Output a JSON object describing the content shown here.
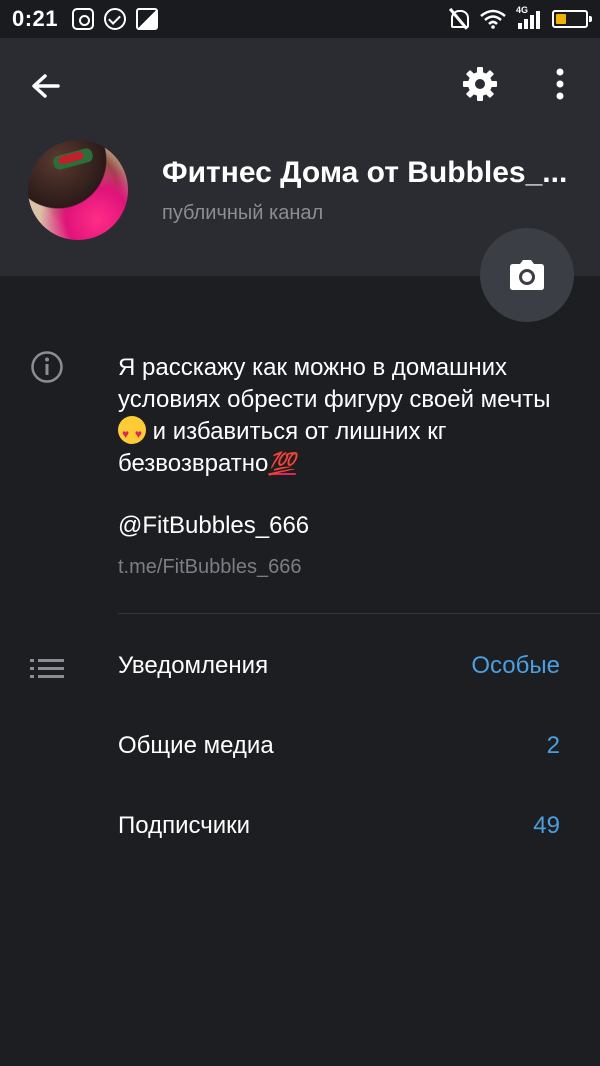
{
  "status_bar": {
    "time": "0:21",
    "network": "4G",
    "battery_level": 0.35,
    "battery_color": "#f0b400",
    "left_icons": [
      "instagram-icon",
      "check-circle-icon",
      "image-icon"
    ],
    "right_icons": [
      "mute-icon",
      "wifi-icon",
      "signal-icon",
      "battery-icon"
    ]
  },
  "toolbar": {
    "back_icon": "arrow-left-icon",
    "settings_icon": "gear-icon",
    "more_icon": "more-vertical-icon"
  },
  "channel": {
    "title": "Фитнес Дома от Bubbles_...",
    "subtitle": "публичный канал"
  },
  "about": {
    "line1": "Я расскажу как можно в домашних условиях обрести фигуру своей мечты ",
    "line2": " и избавиться от лишних кг безвозвратно",
    "emoji_100": "💯",
    "username": "@FitBubbles_666",
    "link": "t.me/FitBubbles_666"
  },
  "settings_rows": [
    {
      "label": "Уведомления",
      "value": "Особые"
    },
    {
      "label": "Общие медиа",
      "value": "2"
    },
    {
      "label": "Подписчики",
      "value": "49"
    }
  ],
  "colors": {
    "accent": "#4a9fe0",
    "header_bg": "#2a2c31",
    "page_bg": "#1d1e22"
  }
}
